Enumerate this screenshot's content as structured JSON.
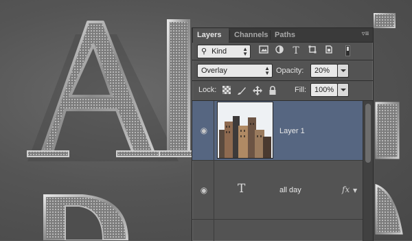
{
  "panel": {
    "tabs": [
      {
        "label": "Layers",
        "active": true
      },
      {
        "label": "Channels",
        "active": false
      },
      {
        "label": "Paths",
        "active": false
      }
    ],
    "menu_icon": "panel-menu-icon",
    "filter": {
      "kind_label": "Kind",
      "icons": [
        "image-filter-icon",
        "adjustment-filter-icon",
        "type-filter-icon",
        "shape-filter-icon",
        "smart-object-filter-icon",
        "filter-toggle-icon"
      ]
    },
    "blend_mode": "Overlay",
    "opacity_label": "Opacity:",
    "opacity_value": "20%",
    "lock_label": "Lock:",
    "lock_icons": [
      "lock-transparent-pixels-icon",
      "lock-image-pixels-icon",
      "lock-position-icon",
      "lock-all-icon"
    ],
    "fill_label": "Fill:",
    "fill_value": "100%",
    "layers": [
      {
        "name": "Layer 1",
        "selected": true,
        "kind": "image",
        "visible": true
      },
      {
        "name": "all day",
        "selected": false,
        "kind": "type",
        "visible": true,
        "fx": "fx"
      },
      {
        "name": "",
        "selected": false,
        "kind": "empty",
        "visible": false
      }
    ],
    "type_glyph": "T",
    "colors": {
      "selected_row": "#566681",
      "panel_bg": "#535353"
    }
  }
}
